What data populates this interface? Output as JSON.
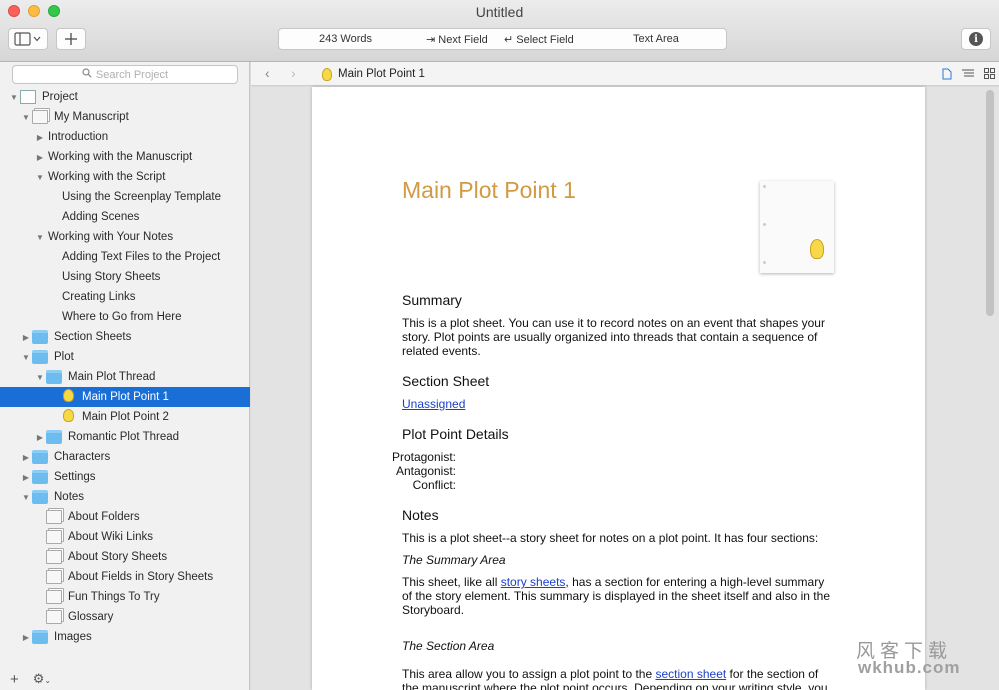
{
  "window": {
    "title": "Untitled"
  },
  "toolbar": {
    "word_count": "243 Words",
    "next_field": "⇥ Next Field",
    "select_field": "↵ Select Field",
    "text_area": "Text Area"
  },
  "sidebar": {
    "search_placeholder": "Search Project",
    "items": [
      {
        "label": "Project",
        "level": 0,
        "disclosure": "open",
        "icon": "project-icon"
      },
      {
        "label": "My Manuscript",
        "level": 1,
        "disclosure": "open",
        "icon": "document-stack-icon"
      },
      {
        "label": "Introduction",
        "level": 2,
        "disclosure": "closed",
        "icon": ""
      },
      {
        "label": "Working with the Manuscript",
        "level": 2,
        "disclosure": "closed",
        "icon": ""
      },
      {
        "label": "Working with the Script",
        "level": 2,
        "disclosure": "open",
        "icon": ""
      },
      {
        "label": "Using the Screenplay Template",
        "level": 3,
        "disclosure": "none",
        "icon": ""
      },
      {
        "label": "Adding Scenes",
        "level": 3,
        "disclosure": "none",
        "icon": ""
      },
      {
        "label": "Working with Your Notes",
        "level": 2,
        "disclosure": "open",
        "icon": ""
      },
      {
        "label": "Adding Text Files to the Project",
        "level": 3,
        "disclosure": "none",
        "icon": ""
      },
      {
        "label": "Using Story Sheets",
        "level": 3,
        "disclosure": "none",
        "icon": ""
      },
      {
        "label": "Creating Links",
        "level": 3,
        "disclosure": "none",
        "icon": ""
      },
      {
        "label": "Where to Go from Here",
        "level": 3,
        "disclosure": "none",
        "icon": ""
      },
      {
        "label": "Section Sheets",
        "level": 1,
        "disclosure": "closed",
        "icon": "folder-icon"
      },
      {
        "label": "Plot",
        "level": 1,
        "disclosure": "open",
        "icon": "folder-icon"
      },
      {
        "label": "Main Plot Thread",
        "level": 2,
        "disclosure": "open",
        "icon": "folder-icon"
      },
      {
        "label": "Main Plot Point 1",
        "level": 3,
        "disclosure": "none",
        "icon": "lightbulb-icon",
        "selected": true
      },
      {
        "label": "Main Plot Point 2",
        "level": 3,
        "disclosure": "none",
        "icon": "lightbulb-icon"
      },
      {
        "label": "Romantic Plot Thread",
        "level": 2,
        "disclosure": "closed",
        "icon": "folder-icon"
      },
      {
        "label": "Characters",
        "level": 1,
        "disclosure": "closed",
        "icon": "folder-icon"
      },
      {
        "label": "Settings",
        "level": 1,
        "disclosure": "closed",
        "icon": "folder-icon"
      },
      {
        "label": "Notes",
        "level": 1,
        "disclosure": "open",
        "icon": "folder-icon"
      },
      {
        "label": "About Folders",
        "level": 2,
        "disclosure": "none",
        "icon": "document-stack-icon"
      },
      {
        "label": "About Wiki Links",
        "level": 2,
        "disclosure": "none",
        "icon": "document-stack-icon"
      },
      {
        "label": "About Story Sheets",
        "level": 2,
        "disclosure": "none",
        "icon": "document-stack-icon"
      },
      {
        "label": "About Fields in Story Sheets",
        "level": 2,
        "disclosure": "none",
        "icon": "document-stack-icon"
      },
      {
        "label": "Fun Things To Try",
        "level": 2,
        "disclosure": "none",
        "icon": "document-stack-icon"
      },
      {
        "label": "Glossary",
        "level": 2,
        "disclosure": "none",
        "icon": "document-stack-icon"
      },
      {
        "label": "Images",
        "level": 1,
        "disclosure": "closed",
        "icon": "folder-icon"
      }
    ]
  },
  "nav": {
    "title": "Main Plot Point 1"
  },
  "document": {
    "title": "Main Plot Point 1",
    "summary_heading": "Summary",
    "summary_text": "This is a plot sheet. You can use it to record notes on an event that shapes your story. Plot points are usually organized into threads that contain a sequence of related events.",
    "section_sheet_heading": "Section Sheet",
    "section_sheet_link": "Unassigned",
    "details_heading": "Plot Point Details",
    "field_protagonist": "Protagonist:",
    "field_antagonist": "Antagonist:",
    "field_conflict": "Conflict:",
    "notes_heading": "Notes",
    "notes_intro": "This is a plot sheet--a story sheet for notes on a plot point. It has four sections:",
    "summary_area_heading": "The Summary Area",
    "summary_area_pre": "This sheet, like all ",
    "summary_area_link": "story sheets",
    "summary_area_post": ", has a section for entering a high-level summary of the story element. This summary is displayed in the sheet itself and also in the Storyboard.",
    "section_area_heading": "The Section Area",
    "section_area_pre": "This area allow you to assign a plot point to the ",
    "section_area_link": "section sheet",
    "section_area_post": " for the section of the manuscript where the plot point occurs. Depending on your writing style, you"
  },
  "watermark": {
    "line1": "风客下载",
    "line2": "wkhub.com"
  },
  "colors": {
    "selection": "#1a6fd6",
    "title_gold": "#d19a45",
    "link": "#1a3fcc",
    "folder": "#6dbcf0"
  }
}
